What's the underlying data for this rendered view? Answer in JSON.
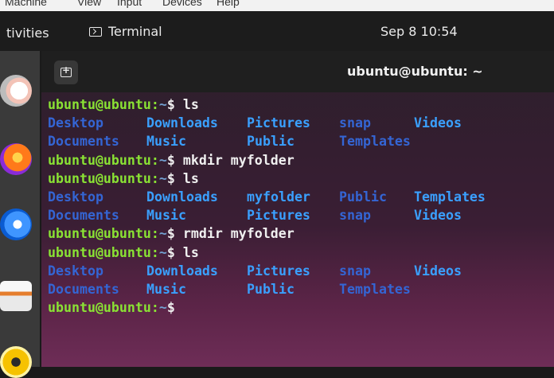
{
  "vm_menu": [
    "Machine",
    "View",
    "Input",
    "Devices",
    "Help"
  ],
  "topbar": {
    "activities": "tivities",
    "app_name": "Terminal",
    "clock": "Sep 8  10:54"
  },
  "window": {
    "title": "ubuntu@ubuntu: ~"
  },
  "terminal": {
    "prompt_user": "ubuntu@ubuntu:",
    "prompt_path": "~",
    "prompt_symbol": "$",
    "lines": [
      {
        "type": "cmd",
        "command": "ls"
      },
      {
        "type": "out",
        "items": [
          "Desktop",
          "Downloads",
          "Pictures",
          "snap",
          "Videos"
        ]
      },
      {
        "type": "out",
        "items": [
          "Documents",
          "Music",
          "Public",
          "Templates"
        ]
      },
      {
        "type": "cmd",
        "command": "mkdir myfolder"
      },
      {
        "type": "cmd",
        "command": "ls"
      },
      {
        "type": "out",
        "items": [
          "Desktop",
          "Downloads",
          "myfolder",
          "Public",
          "Templates"
        ]
      },
      {
        "type": "out",
        "items": [
          "Documents",
          "Music",
          "Pictures",
          "snap",
          "Videos"
        ]
      },
      {
        "type": "cmd",
        "command": "rmdir myfolder"
      },
      {
        "type": "cmd",
        "command": "ls"
      },
      {
        "type": "out",
        "items": [
          "Desktop",
          "Downloads",
          "Pictures",
          "snap",
          "Videos"
        ]
      },
      {
        "type": "out",
        "items": [
          "Documents",
          "Music",
          "Public",
          "Templates"
        ]
      },
      {
        "type": "prompt"
      }
    ]
  },
  "dock": [
    "help-icon",
    "firefox-icon",
    "thunderbird-icon",
    "files-icon",
    "rhythmbox-icon"
  ]
}
